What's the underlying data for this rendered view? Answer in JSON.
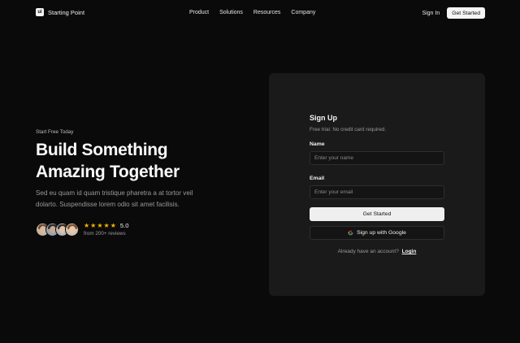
{
  "header": {
    "logo_glyph": "ui",
    "brand": "Starting Point",
    "nav": [
      "Product",
      "Solutions",
      "Resources",
      "Company"
    ],
    "signin": "Sign In",
    "cta": "Get Started"
  },
  "hero": {
    "eyebrow": "Start Free Today",
    "headline_line1": "Build Something",
    "headline_line2": "Amazing Together",
    "subtext": "Sed eu quam id quam tristique pharetra a at tortor veil dolarto. Suspendisse lorem odio sit amet facilisis.",
    "rating_score": "5.0",
    "rating_count": 5,
    "reviews": "from 200+ reviews",
    "avatar_count": 4
  },
  "signup": {
    "title": "Sign Up",
    "subtitle": "Free trial. No credit card required.",
    "name_label": "Name",
    "name_placeholder": "Enter your name",
    "email_label": "Email",
    "email_placeholder": "Enter your email",
    "submit": "Get Started",
    "google": "Sign up with Google",
    "login_prompt": "Already have an account?",
    "login_link": "Login"
  },
  "colors": {
    "background": "#0a0a0a",
    "card": "#1a1a1a",
    "star": "#f5b400"
  },
  "icons": [
    "logo-icon",
    "star-icon",
    "google-icon",
    "avatar"
  ]
}
